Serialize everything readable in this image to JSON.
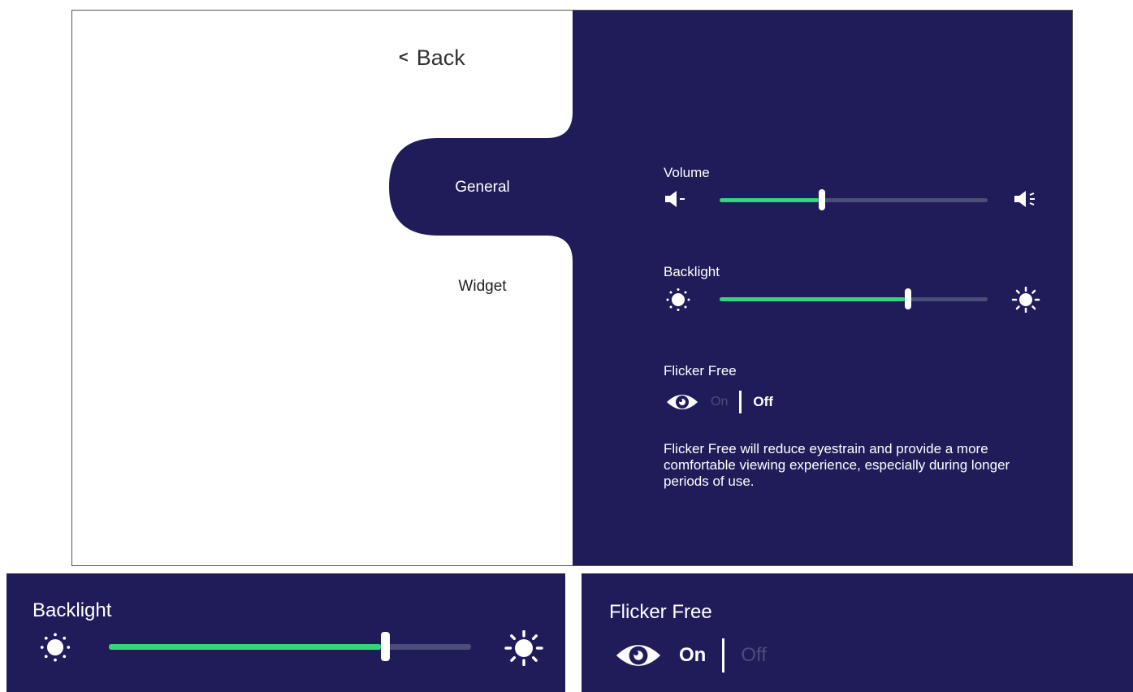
{
  "nav": {
    "back_label": "Back",
    "tabs": [
      {
        "label": "General",
        "selected": true
      },
      {
        "label": "Widget",
        "selected": false
      }
    ]
  },
  "settings": {
    "volume": {
      "label": "Volume",
      "level": 0.37
    },
    "backlight": {
      "label": "Backlight",
      "level": 0.69
    },
    "flicker_free": {
      "label": "Flicker Free",
      "on_label": "On",
      "off_label": "Off",
      "state": "Off",
      "description": "Flicker Free will reduce eyestrain and provide a more comfortable viewing experience, especially during longer periods of use."
    }
  },
  "zoom_backlight": {
    "label": "Backlight",
    "level": 0.75
  },
  "zoom_flicker": {
    "label": "Flicker Free",
    "on_label": "On",
    "off_label": "Off",
    "state": "On"
  },
  "colors": {
    "panel": "#201c5a",
    "accent": "#34d67c",
    "track": "#4b4e78"
  }
}
